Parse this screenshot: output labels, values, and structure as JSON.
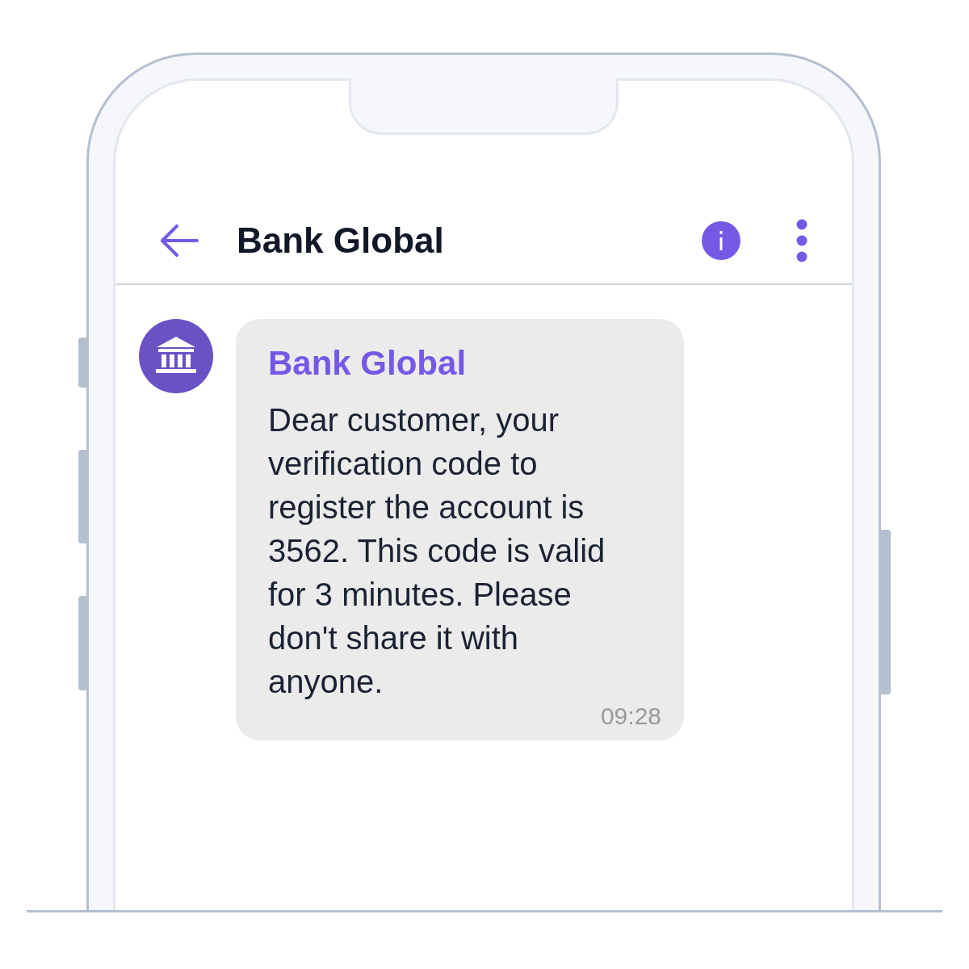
{
  "header": {
    "title": "Bank Global"
  },
  "message": {
    "sender": "Bank Global",
    "text": "Dear customer, your verification code to register the account is 3562. This code is valid for 3 minutes. Please don't share it with anyone.",
    "time": "09:28"
  }
}
